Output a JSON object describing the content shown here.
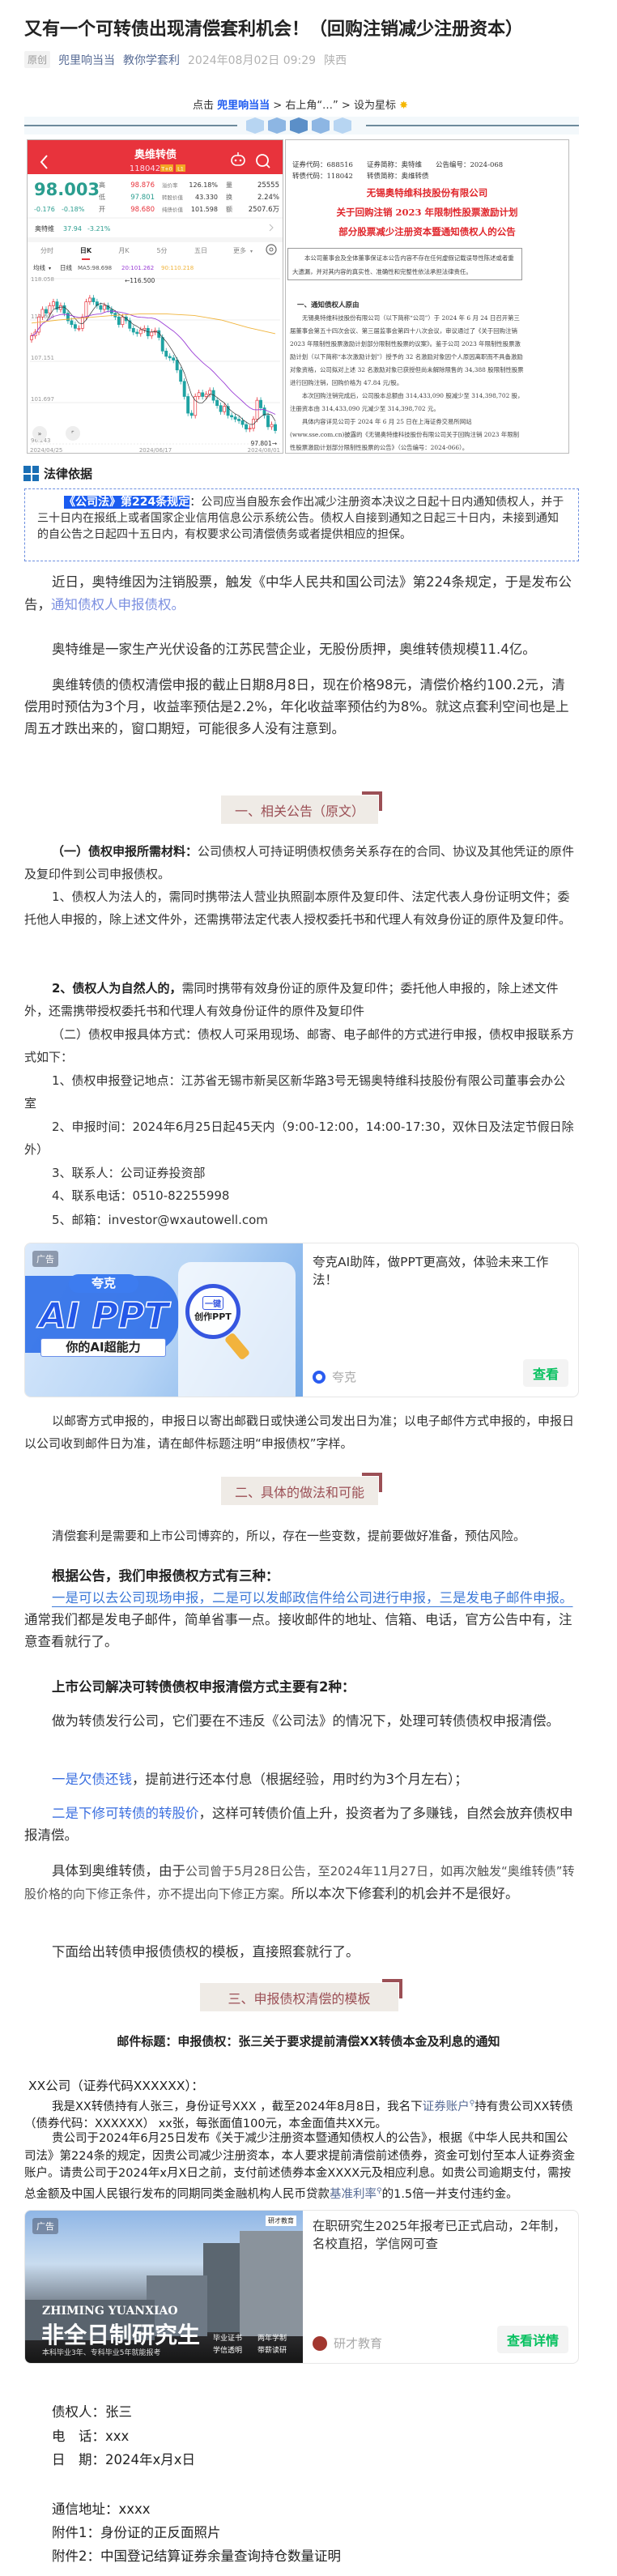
{
  "article": {
    "title": "又有一个可转债出现清偿套利机会！（回购注销减少注册资本）",
    "original_tag": "原创",
    "author": "兜里响当当",
    "account": "教你学套利",
    "date": "2024年08月02日 09:29",
    "location": "陕西"
  },
  "follow_prompt": {
    "prefix": "点击 ",
    "account": "兜里响当当",
    "suffix": " > 右上角“…” > 设为星标",
    "icon": "sun-star-icon"
  },
  "stock_card": {
    "title": "奥维转债",
    "code": "118042",
    "badges": [
      "T+0",
      "L1"
    ],
    "price": "98.003",
    "change": "-0.176",
    "change_pct": "-0.18%",
    "stats": [
      {
        "label": "高",
        "value": "98.876",
        "color": "#e8333c"
      },
      {
        "label": "低",
        "value": "97.801",
        "color": "#2a9d8f"
      },
      {
        "label": "开",
        "value": "98.680",
        "color": "#e8333c"
      }
    ],
    "stats2": [
      {
        "label": "溢价率",
        "value": "126.18%"
      },
      {
        "label": "转股价值",
        "value": "43.330"
      },
      {
        "label": "纯债价值",
        "value": "101.598"
      }
    ],
    "stats3": [
      {
        "label": "量",
        "value": "25555"
      },
      {
        "label": "换",
        "value": "2.24%"
      },
      {
        "label": "额",
        "value": "2507.6万"
      }
    ],
    "underlying": {
      "name": "奥特维",
      "price": "37.94",
      "change_pct": "-3.21%"
    },
    "tabs": [
      "分时",
      "日K",
      "月K",
      "5分",
      "五日",
      "更多"
    ],
    "active_tab": "日K",
    "ma_legend": {
      "selector": "均线",
      "period": "日线",
      "ma5": "MA5:98.698",
      "ma20": "20:101.262",
      "ma90": "90:110.218"
    },
    "colors": {
      "header": "#e8333c",
      "up": "#e8333c",
      "down": "#1fa3a3",
      "ma5": "#333333",
      "ma20": "#9b3fd6",
      "ma90": "#f0b43c"
    },
    "chart": {
      "y_ticks": [
        "118.058",
        "112.604",
        "107.151",
        "101.697",
        "96.243"
      ],
      "x_ticks": [
        "2024/04/25",
        "2024/06/17",
        "2024/08/01"
      ],
      "high_marker": "←116.500",
      "low_marker": "97.801→",
      "closes": [
        110.5,
        111,
        113,
        114,
        113.5,
        114.5,
        115,
        114,
        114.5,
        113.5,
        112.5,
        112,
        111.5,
        111.5,
        113,
        115,
        115.5,
        115,
        114.5,
        114,
        114.5,
        114,
        113.5,
        113,
        112,
        113,
        112.5,
        111.5,
        111,
        110.8,
        111.3,
        111.5,
        110.5,
        111,
        111.2,
        110.3,
        108.5,
        107.8,
        107.6,
        107.3,
        106,
        104.5,
        102.5,
        100.3,
        100,
        102.5,
        103,
        102.5,
        102.8,
        103.3,
        102,
        101.3,
        100.5,
        101.2,
        100,
        99.8,
        99.5,
        99.3,
        98.8,
        98.2,
        98.3,
        99.5,
        102,
        101,
        100,
        98.5,
        98.8,
        98
      ],
      "ma90": [
        112.2,
        112.6,
        112.9,
        113.2,
        113.4,
        113.4,
        113.2,
        112.6,
        111.6,
        110.8
      ]
    }
  },
  "announcement_image": {
    "line1": "证券代码：688516　　证券简称：奥特维　　公告编号：2024-068",
    "line2": "转债代码：118042　　转债简称：奥维转债",
    "company": "无锡奥特维科技股份有限公司",
    "title1": "关于回购注销 2023 年限制性股票激励计划",
    "title2": "部分股票减少注册资本暨通知债权人的公告",
    "disclaimer": "本公司董事会及全体董事保证本公告内容不存在任何虚假记载误导性陈述或者重大遗漏，并对其内容的真实性、准确性和完整性依法承担法律责任。",
    "section": "一、通知债权人原由",
    "p1": "无锡奥特维科技股份有限公司（以下简称“公司”）于 2024 年 6 月 24 日召开第三届董事会第五十四次会议、第三届监事会第四十八次会议，审议通过了《关于回购注销 2023 年限制性股票激励计划部分限制性股票的议案》。鉴于公司 2023 年限制性股票激励计划（以下简称“本次激励计划”）授予的 32 名激励对象因个人原因离职而不具备激励对象资格，公司拟对上述 32 名激励对象已获授但尚未解除限售的 34,388 股限制性股票进行回购注销，回购价格为 47.84 元/股。",
    "p2": "本次回购注销完成后，公司股本总额由 314,433,090 股减少至 314,398,702 股，注册资本由 314,433,090 元减少至 314,398,702 元。",
    "p3": "具体内容详见公司于 2024 年 6 月 25 日在上海证券交易所网站(www.sse.com.cn)披露的《无锡奥特维科技股份有限公司关于回购注销 2023 年限制性股票激励计划部分限制性股票的公告》（公告编号：2024-066）。"
  },
  "legal_basis": {
    "heading": "法律依据",
    "highlight": "《公司法》第224条规定",
    "text": "：公司应当自股东会作出减少注册资本决议之日起十日内通知债权人，并于三十日内在报纸上或者国家企业信用信息公示系统公告。债权人自接到通知之日起三十日内，未接到通知的自公告之日起四十五日内，有权要求公司清偿债务或者提供相应的担保。"
  },
  "intro": {
    "p1": "近日，奥特维因为注销股票，触发《中华人民共和国公司法》第224条规定，于是发布公告，",
    "p1_link": "通知债权人申报债权。",
    "p2": "奥特维是一家生产光伏设备的江苏民营企业，无股份质押，奥维转债规模11.4亿。",
    "p3": "奥维转债的债权清偿申报的截止日期8月8日，现在价格98元，清偿价格约100.2元，清偿用时预估为3个月，收益率预估是2.2%，年化收益率预估约为8%。就这点套利空间也是上周五才跌出来的，窗口期短，可能很多人没有注意到。"
  },
  "section1": {
    "heading": "一、相关公告（原文）",
    "materials_bold": "（一）债权申报所需材料：",
    "materials": "公司债权人可持证明债权债务关系存在的合同、协议及其他凭证的原件及复印件到公司申报债权。",
    "item1": "1、债权人为法人的，需同时携带法人营业执照副本原件及复印件、法定代表人身份证明文件；委托他人申报的，除上述文件外，还需携带法定代表人授权委托书和代理人有效身份证的原件及复印件。",
    "item2_bold": "2、债权人为自然人的，",
    "item2": "需同时携带有效身份证的原件及复印件；委托他人申报的，除上述文件外，还需携带授权委托书和代理人有效身份证件的原件及复印件",
    "method": "（二）债权申报具体方式：债权人可采用现场、邮寄、电子邮件的方式进行申报，债权申报联系方式如下：",
    "c1": "1、债权申报登记地点：江苏省无锡市新吴区新华路3号无锡奥特维科技股份有限公司董事会办公室",
    "c2": "2、申报时间：2024年6月25日起45天内（9:00-12:00，14:00-17:30，双休日及法定节假日除外）",
    "c3": "3、联系人：公司证券投资部",
    "c4": "4、联系电话：0510-82255998",
    "c5": "5、邮箱：investor@wxautowell.com",
    "mail_note": "以邮寄方式申报的，申报日以寄出邮戳日或快递公司发出日为准；以电子邮件方式申报的，申报日以公司收到邮件日为准，请在邮件标题注明“申报债权”字样。"
  },
  "ad1": {
    "tag": "广告",
    "pill": "夸克",
    "big": "AI PPT",
    "slogan": "你的AI超能力",
    "mag1": "一键",
    "mag2": "创作PPT",
    "title": "夸克AI助阵，做PPT更高效，体验未来工作法！",
    "advertiser": "夸克",
    "button": "查看"
  },
  "section2": {
    "heading": "二、具体的做法和可能",
    "p1": "清偿套利是需要和上市公司博弈的，所以，存在一些变数，提前要做好准备，预估风险。",
    "three_bold": "根据公告，我们申报债权方式有三种：",
    "three_link": "一是可以去公司现场申报，二是可以发邮政信件给公司进行申报，三是发电子邮件申报。",
    "three_rest": "通常我们都是发电子邮件，简单省事一点。接收邮件的地址、信箱、电话，官方公告中有，注意查看就行了。",
    "two_bold": "上市公司解决可转债债权申报清偿方式主要有2种：",
    "two_intro": "做为转债发行公司，它们要在不违反《公司法》的情况下，处理可转债债权申报清偿。",
    "way1_link": "一是欠债还钱",
    "way1": "，提前进行还本付息（根据经验，用时约为3个月左右）；",
    "way2_link": "二是下修可转债的转股价",
    "way2": "，这样可转债价值上升，投资者为了多赚钱，自然会放弃债权申报清偿。",
    "case_a": "具体到奥维转债，由于",
    "case_b": "公司曾于5月28日公告，至2024年11月27日，如再次触发“奥维转债”转股价格的向下修正条件，亦不提出向下修正方案。",
    "case_c": "所以本次下修套利的机会并不是很好。",
    "template_intro": "下面给出转债申报债债权的模板，直接照套就行了。"
  },
  "section3": {
    "heading": "三、申报债权清偿的模板",
    "mail_title": "邮件标题：申报债权：张三关于要求提前清偿XX转债本金及利息的通知",
    "salutation": "XX公司（证券代码XXXXXX）：",
    "body1_a": "我是XX转债持有人张三，身份证号XXX ，截至2024年8月8日，我名下",
    "body1_link": "证券账户",
    "body1_b": "持有贵公司XX转债（债券代码：XXXXXX） xx张，每张面值100元，本金面值共XX元。",
    "body2_a": "贵公司于2024年6月25日发布《关于减少注册资本暨通知债权人的公告》，根据《中华人民共和国公司法》第224条的规定，因贵公司减少注册资本，本人要求提前清偿前述债券，资金可划付至本人证券资金账户。请贵公司于2024年x月X日之前，支付前述债券本金XXXX元及相应利息。如贵公司逾期支付，需按总金额及中国人民银行发布的同期同类金融机构人民币贷款",
    "body2_link": "基准利率",
    "body2_b": "的1.5倍一并支付违约金。",
    "creditor": "债权人：张三",
    "phone": "电　话：xxx",
    "date": "日　期：2024年x月x日",
    "address": "通信地址：xxxx",
    "att1": "附件1：身份证的正反面照片",
    "att2": "附件2：中国登记结算证券余量查询持仓数量证明"
  },
  "ad2": {
    "tag": "广告",
    "brand_tag": "研才教育",
    "en": "ZHIMING YUANXIAO",
    "big": "非全日制研究生",
    "sub": "本科毕业3年、专科毕业5年就能报考",
    "badges": [
      "毕业证书",
      "两年学制",
      "学信透明",
      "带薪读研"
    ],
    "title": "在职研究生2025年报考已正式启动，2年制，名校直招，学信网可查",
    "advertiser": "研才教育",
    "button": "查看详情"
  }
}
